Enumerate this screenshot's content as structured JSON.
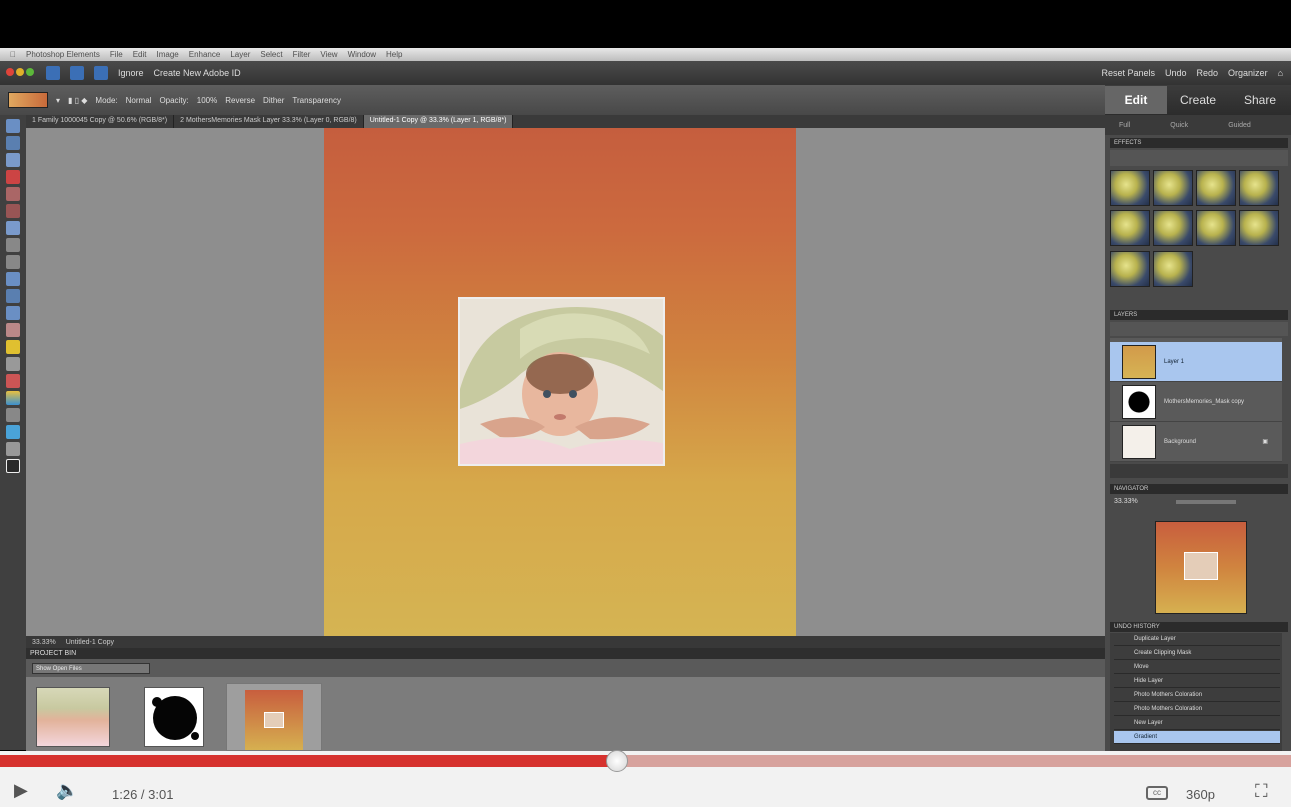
{
  "mac_menubar": {
    "items": [
      "Photoshop Elements",
      "File",
      "Edit",
      "Image",
      "Enhance",
      "Layer",
      "Select",
      "Filter",
      "View",
      "Window",
      "Help"
    ]
  },
  "app_menubar": {
    "ignore": "Ignore",
    "create_new": "Create New Adobe ID",
    "reset_panels": "Reset Panels",
    "undo": "Undo",
    "redo": "Redo",
    "organizer": "Organizer"
  },
  "options": {
    "mode_label": "Mode:",
    "mode_value": "Normal",
    "opacity_label": "Opacity:",
    "opacity_value": "100%",
    "reverse": "Reverse",
    "dither": "Dither",
    "transparency": "Transparency"
  },
  "doc_tabs": [
    "1 Family 1000045 Copy @ 50.6% (RGB/8*)",
    "2 MothersMemories Mask Layer 33.3% (Layer 0, RGB/8)",
    "Untitled-1 Copy @ 33.3% (Layer 1, RGB/8*)"
  ],
  "status": {
    "zoom": "33.33%",
    "doc_info": "Untitled-1 Copy"
  },
  "project_bin": {
    "title": "PROJECT BIN",
    "filter": "Show Open Files"
  },
  "mode_tabs": [
    "Edit",
    "Create",
    "Share"
  ],
  "sub_tabs": [
    "Full",
    "Quick",
    "Guided"
  ],
  "panels": {
    "effects": "EFFECTS",
    "layers": "LAYERS",
    "navigator": "NAVIGATOR",
    "undo_history": "UNDO HISTORY",
    "navigator_zoom": "33.33%"
  },
  "layers": [
    {
      "name": "Layer 1",
      "selected": true
    },
    {
      "name": "MothersMemories_Mask copy",
      "selected": false
    },
    {
      "name": "Background",
      "selected": false
    }
  ],
  "history": [
    {
      "label": "Duplicate Layer",
      "selected": false
    },
    {
      "label": "Create Clipping Mask",
      "selected": false
    },
    {
      "label": "Move",
      "selected": false
    },
    {
      "label": "Hide Layer",
      "selected": false
    },
    {
      "label": "Photo Mothers Coloration",
      "selected": false
    },
    {
      "label": "Photo Mothers Coloration",
      "selected": false
    },
    {
      "label": "New Layer",
      "selected": false
    },
    {
      "label": "Gradient",
      "selected": true
    }
  ],
  "video": {
    "time": "1:26 / 3:01",
    "quality": "360p",
    "progress": 0.478,
    "colors": {
      "played": "#d6322e",
      "buffered": "#d7a29d"
    }
  }
}
